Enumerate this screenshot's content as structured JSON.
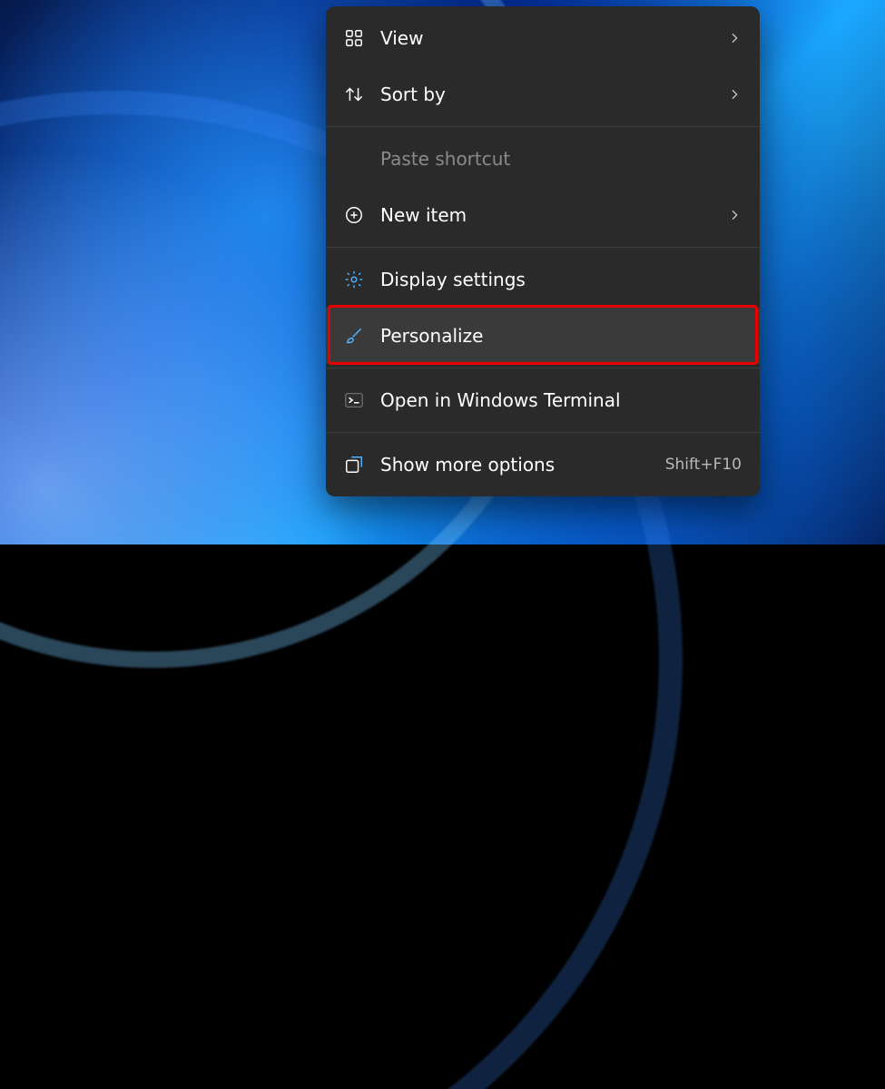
{
  "menu": {
    "view": {
      "label": "View"
    },
    "sort_by": {
      "label": "Sort by"
    },
    "paste_shortcut": {
      "label": "Paste shortcut"
    },
    "new_item": {
      "label": "New item"
    },
    "display_settings": {
      "label": "Display settings"
    },
    "personalize": {
      "label": "Personalize"
    },
    "open_terminal": {
      "label": "Open in Windows Terminal"
    },
    "show_more": {
      "label": "Show more options",
      "shortcut": "Shift+F10"
    }
  },
  "highlight_target": "personalize"
}
